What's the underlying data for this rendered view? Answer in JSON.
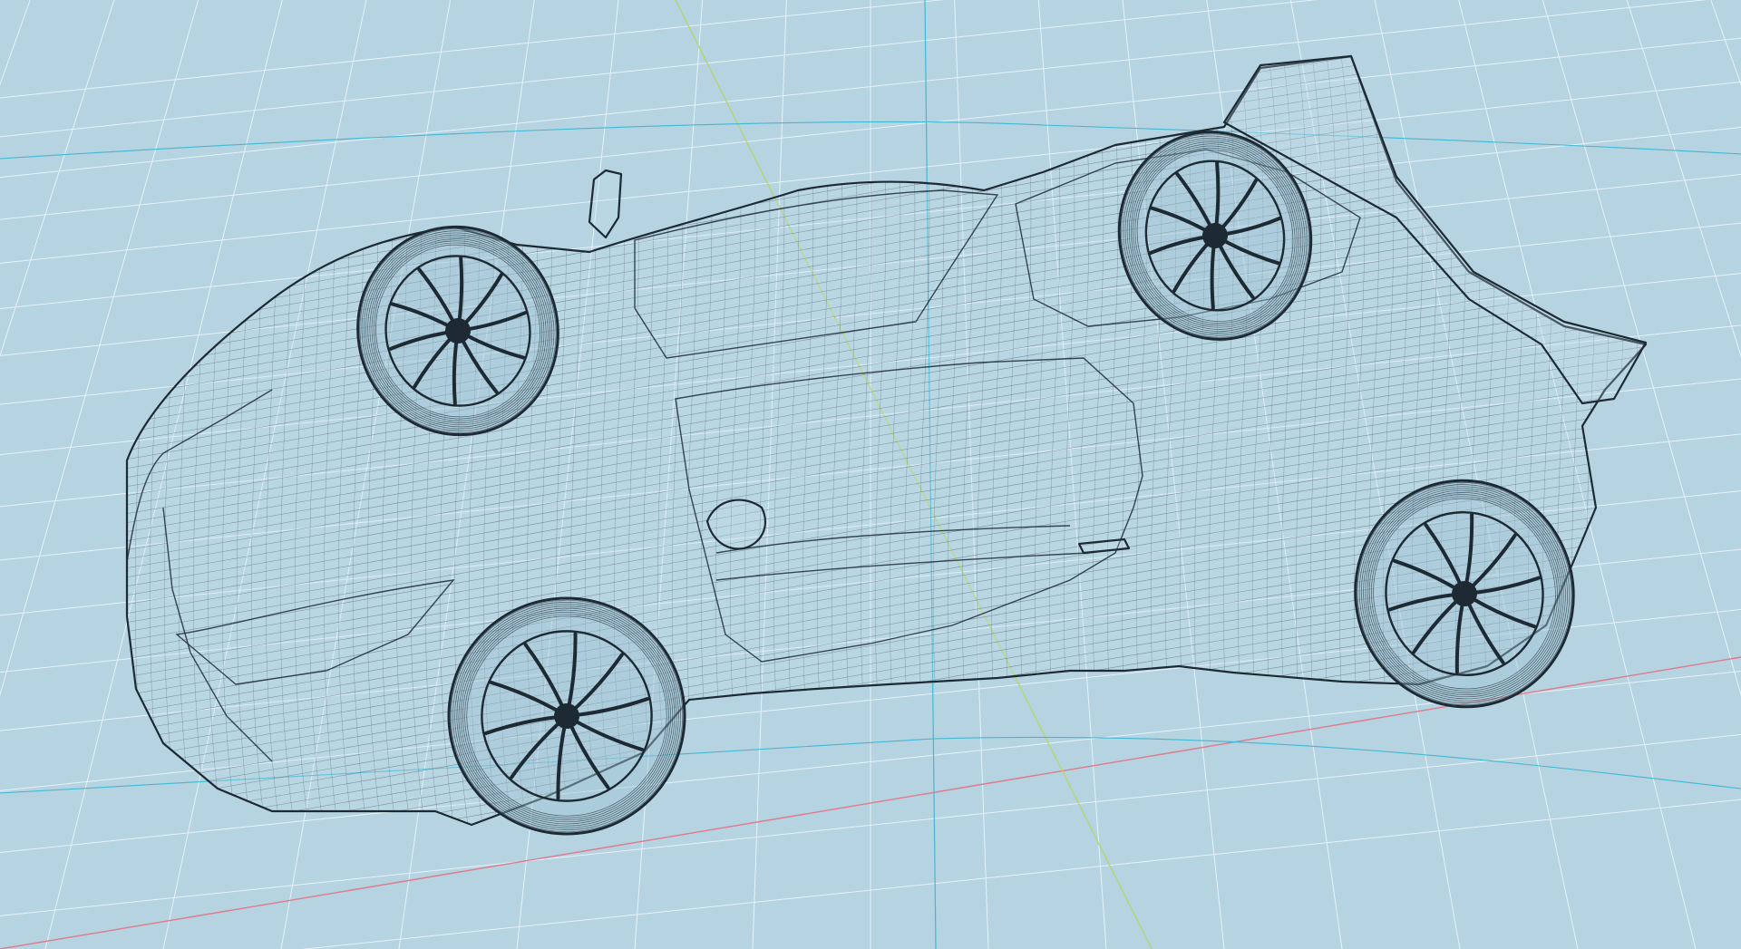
{
  "viewport": {
    "view": "perspective",
    "background_color": "#b5d3e1",
    "grid_color": "#e6f2f8",
    "axis_x_color": "#e07a8a",
    "axis_y_color": "#b7d56a",
    "axis_z_color": "#41b8d4",
    "wire_color": "#1d2a33",
    "grid_visible": true
  },
  "model": {
    "display_mode": "wireframe",
    "subject": "sports car",
    "parts": [
      "body",
      "front-left-wheel",
      "front-right-wheel",
      "rear-left-wheel",
      "rear-right-wheel",
      "rear-wing",
      "side-mirror",
      "door",
      "side-window",
      "rear-window"
    ]
  }
}
